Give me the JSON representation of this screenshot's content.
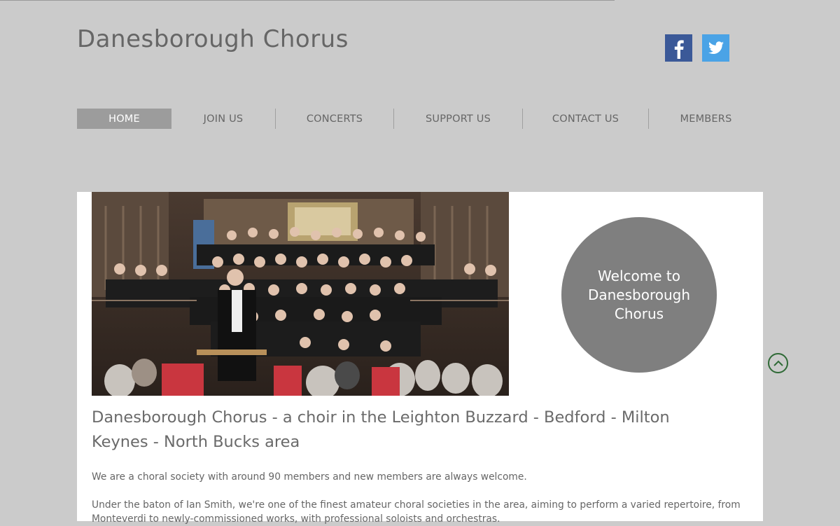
{
  "site": {
    "title": "Danesborough Chorus"
  },
  "social": [
    {
      "name": "facebook-icon",
      "glyph": "f"
    },
    {
      "name": "twitter-icon",
      "glyph": "twitter"
    }
  ],
  "nav": {
    "items": [
      {
        "label": "HOME",
        "active": true
      },
      {
        "label": "JOIN US",
        "active": false
      },
      {
        "label": "CONCERTS",
        "active": false
      },
      {
        "label": "SUPPORT US",
        "active": false
      },
      {
        "label": "CONTACT US",
        "active": false
      },
      {
        "label": "MEMBERS",
        "active": false
      }
    ]
  },
  "hero": {
    "welcome_text": "Welcome to Danesborough Chorus"
  },
  "content": {
    "headline": "Danesborough Chorus - a choir in the Leighton Buzzard - Bedford - Milton Keynes - North Bucks area",
    "paragraph1": "We are a choral society with around 90 members and new members are always welcome.",
    "paragraph2": "Under the baton of Ian Smith, we're one of the finest amateur choral societies in the area, aiming to perform a varied repertoire, from Monteverdi to newly-commissioned works, with professional soloists and orchestras."
  },
  "colors": {
    "background": "#cbcbcb",
    "nav_active": "#9c9c9c",
    "circle": "#7f7f7f",
    "facebook": "#3b5998",
    "twitter": "#4aa3e6",
    "scroll_button": "#2f6a36"
  }
}
